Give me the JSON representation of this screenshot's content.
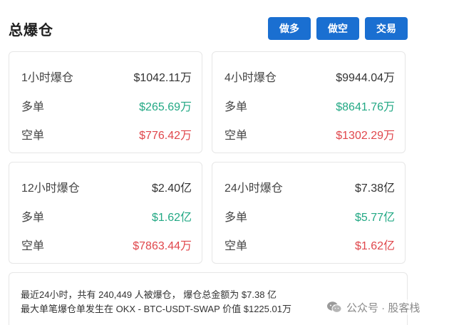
{
  "header": {
    "title": "总爆仓",
    "buttons": {
      "long": "做多",
      "short": "做空",
      "trade": "交易"
    }
  },
  "cards": [
    {
      "period": "1小时爆仓",
      "total": "$1042.11万",
      "long_label": "多单",
      "long_value": "$265.69万",
      "short_label": "空单",
      "short_value": "$776.42万"
    },
    {
      "period": "4小时爆仓",
      "total": "$9944.04万",
      "long_label": "多单",
      "long_value": "$8641.76万",
      "short_label": "空单",
      "short_value": "$1302.29万"
    },
    {
      "period": "12小时爆仓",
      "total": "$2.40亿",
      "long_label": "多单",
      "long_value": "$1.62亿",
      "short_label": "空单",
      "short_value": "$7863.44万"
    },
    {
      "period": "24小时爆仓",
      "total": "$7.38亿",
      "long_label": "多单",
      "long_value": "$5.77亿",
      "short_label": "空单",
      "short_value": "$1.62亿"
    }
  ],
  "summary": {
    "line1": "最近24小时，共有 240,449 人被爆仓， 爆仓总金额为 $7.38 亿",
    "line2": "最大单笔爆仓单发生在 OKX - BTC-USDT-SWAP 价值 $1225.01万"
  },
  "watermark": {
    "text": "公众号 · 股客栈",
    "icon": "wechat-icon"
  },
  "colors": {
    "accent": "#1a6fd1",
    "long": "#22a884",
    "short": "#e0474c"
  }
}
